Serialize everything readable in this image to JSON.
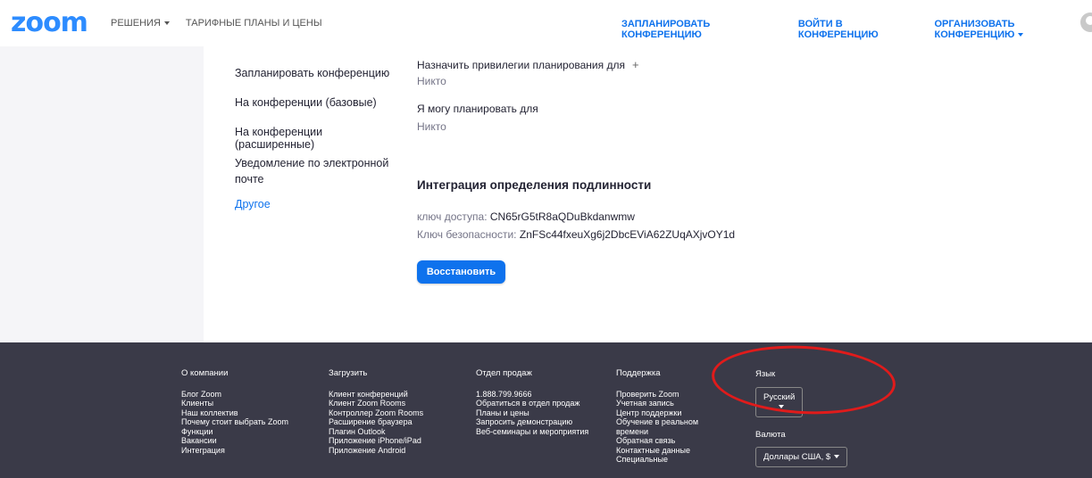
{
  "header": {
    "logo": "zoom",
    "nav_left": [
      "РЕШЕНИЯ",
      "ТАРИФНЫЕ ПЛАНЫ И ЦЕНЫ"
    ],
    "nav_right": [
      "ЗАПЛАНИРОВАТЬ КОНФЕРЕНЦИЮ",
      "ВОЙТИ В КОНФЕРЕНЦИЮ",
      "ОРГАНИЗОВАТЬ КОНФЕРЕНЦИЮ"
    ]
  },
  "settings_menu": [
    "Запланировать конференцию",
    "На конференции (базовые)",
    "На конференции (расширенные)",
    "Уведомление по электронной почте",
    "Другое"
  ],
  "main": {
    "priv_label": "Назначить привилегии планирования для",
    "priv_plus": "+",
    "priv_value": "Никто",
    "can_schedule_label": "Я могу планировать для",
    "can_schedule_value": "Никто",
    "auth_title": "Интеграция определения подлинности",
    "access_key_label": "ключ доступа:",
    "access_key_value": "CN65rG5tR8aQDuBkdanwmw",
    "security_key_label": "Ключ безопасности:",
    "security_key_value": "ZnFSc44fxeuXg6j2DbcEViA62ZUqAXjvOY1d",
    "restore_button": "Восстановить"
  },
  "footer": {
    "col1": {
      "title": "О компании",
      "items": [
        "Блог Zoom",
        "Клиенты",
        "Наш коллектив",
        "Почему стоит выбрать Zoom",
        "Функции",
        "Вакансии",
        "Интеграция"
      ]
    },
    "col2": {
      "title": "Загрузить",
      "items": [
        "Клиент конференций",
        "Клиент Zoom Rooms",
        "Контроллер Zoom Rooms",
        "Расширение браузера",
        "Плагин Outlook",
        "Приложение iPhone/iPad",
        "Приложение Android"
      ]
    },
    "col3": {
      "title": "Отдел продаж",
      "items": [
        "1.888.799.9666",
        "Обратиться в отдел продаж",
        "Планы и цены",
        "Запросить демонстрацию",
        "Веб-семинары и мероприятия"
      ]
    },
    "col4": {
      "title": "Поддержка",
      "items": [
        "Проверить Zoom",
        "Учетная запись",
        "Центр поддержки",
        "Обучение в реальном времени",
        "Обратная связь",
        "Контактные данные",
        "Специальные"
      ]
    },
    "language_label": "Язык",
    "language_value": "Русский",
    "currency_label": "Валюта",
    "currency_value": "Доллары США, $"
  },
  "colors": {
    "brand": "#2D8CFF",
    "link": "#0E72ED",
    "footer_bg": "#3a3a48",
    "annotation": "#e01b1b"
  }
}
